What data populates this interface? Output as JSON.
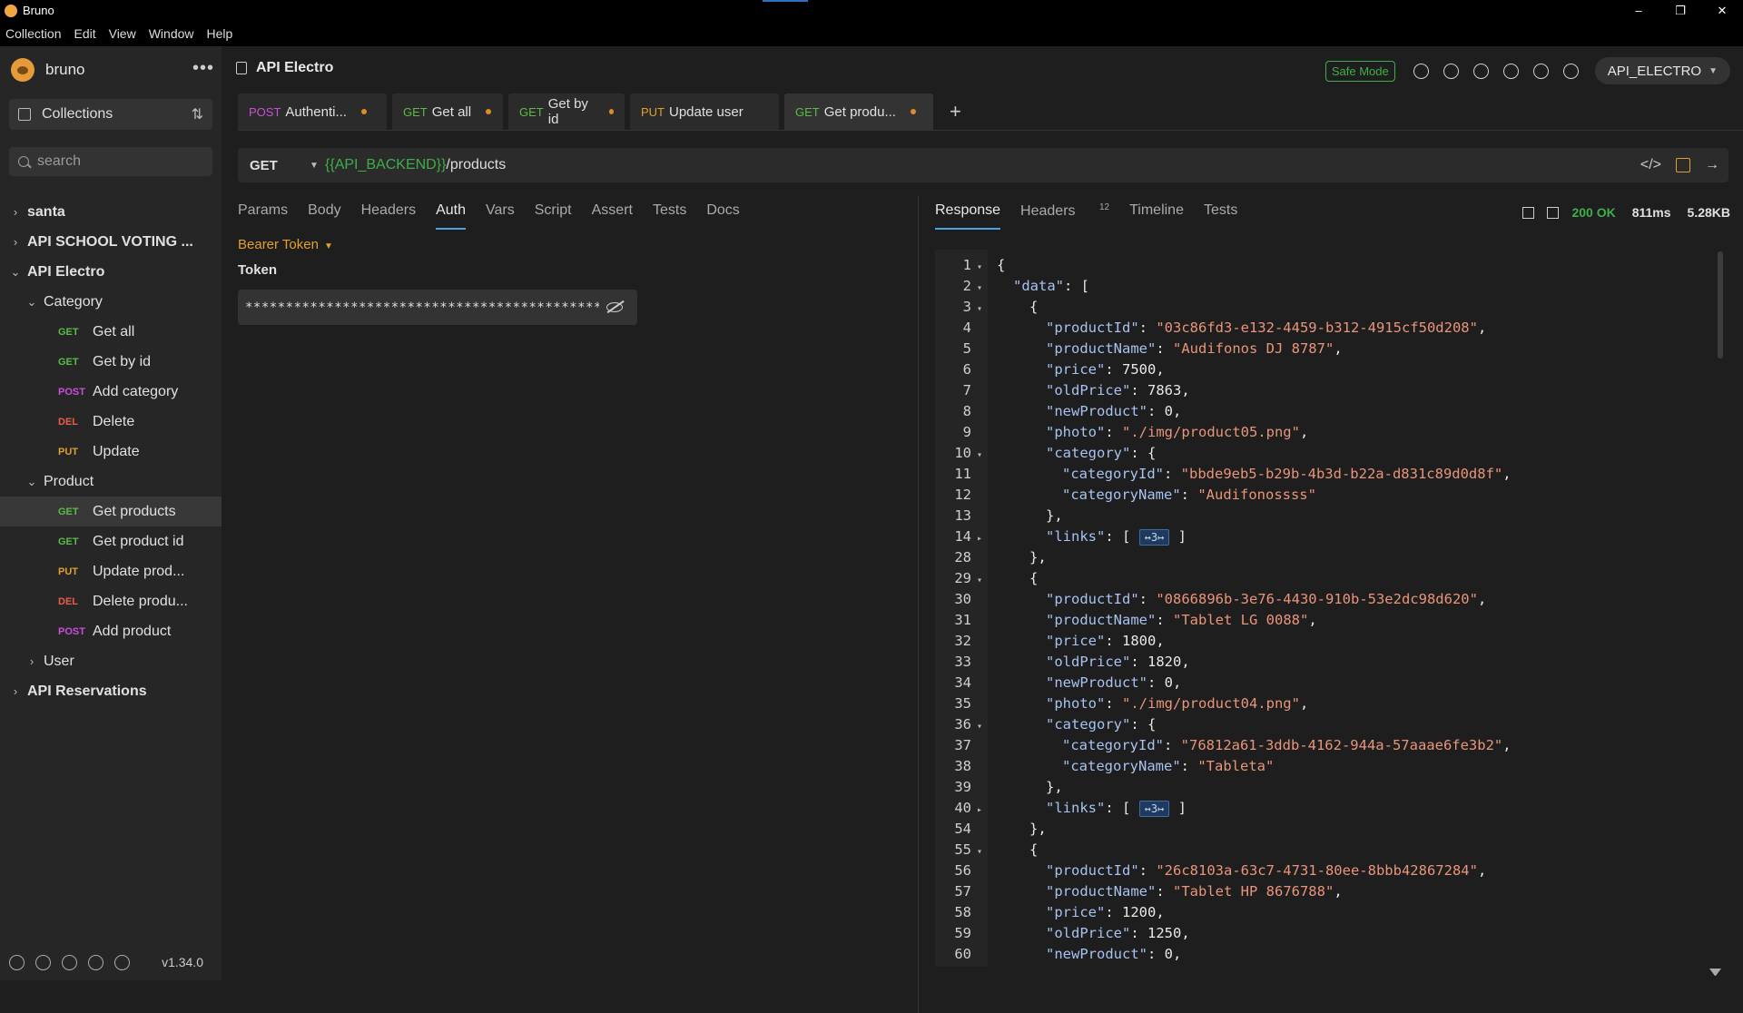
{
  "window": {
    "title": "Bruno",
    "controls": [
      "–",
      "❐",
      "✕"
    ]
  },
  "menu": [
    "Collection",
    "Edit",
    "View",
    "Window",
    "Help"
  ],
  "sidebar": {
    "brand": "bruno",
    "collections_label": "Collections",
    "search_placeholder": "search",
    "tree": [
      {
        "label": "santa",
        "level": 0,
        "chev": "›",
        "bold": true
      },
      {
        "label": "API SCHOOL VOTING ...",
        "level": 0,
        "chev": "›",
        "bold": true
      },
      {
        "label": "API Electro",
        "level": 0,
        "chev": "⌄",
        "bold": true
      },
      {
        "label": "Category",
        "level": 1,
        "chev": "⌄"
      },
      {
        "label": "Get all",
        "level": 2,
        "method": "GET"
      },
      {
        "label": "Get by id",
        "level": 2,
        "method": "GET"
      },
      {
        "label": "Add category",
        "level": 2,
        "method": "POST"
      },
      {
        "label": "Delete",
        "level": 2,
        "method": "DEL"
      },
      {
        "label": "Update",
        "level": 2,
        "method": "PUT"
      },
      {
        "label": "Product",
        "level": 1,
        "chev": "⌄"
      },
      {
        "label": "Get products",
        "level": 2,
        "method": "GET",
        "selected": true
      },
      {
        "label": "Get product id",
        "level": 2,
        "method": "GET"
      },
      {
        "label": "Update prod...",
        "level": 2,
        "method": "PUT"
      },
      {
        "label": "Delete produ...",
        "level": 2,
        "method": "DEL"
      },
      {
        "label": "Add product",
        "level": 2,
        "method": "POST"
      },
      {
        "label": "User",
        "level": 1,
        "chev": "›"
      },
      {
        "label": "API Reservations",
        "level": 0,
        "chev": "›",
        "bold": true
      }
    ],
    "version": "v1.34.0"
  },
  "header": {
    "collection_title": "API Electro",
    "safe_mode": "Safe Mode",
    "environment": "API_ELECTRO"
  },
  "tabs": [
    {
      "method": "POST",
      "label": "Authenti...",
      "unsaved": true
    },
    {
      "method": "GET",
      "label": "Get all",
      "unsaved": true
    },
    {
      "method": "GET",
      "label": "Get by id",
      "unsaved": true
    },
    {
      "method": "PUT",
      "label": "Update user",
      "unsaved": false
    },
    {
      "method": "GET",
      "label": "Get produ...",
      "unsaved": true,
      "active": true
    }
  ],
  "request": {
    "method": "GET",
    "url_variable": "{{API_BACKEND}}",
    "url_path": "/products",
    "tabs": [
      "Params",
      "Body",
      "Headers",
      "Auth",
      "Vars",
      "Script",
      "Assert",
      "Tests",
      "Docs"
    ],
    "active_tab": "Auth",
    "auth_mode": "Bearer Token",
    "token_label": "Token",
    "token_masked": "**************************************************"
  },
  "response": {
    "tabs": [
      "Response",
      "Headers",
      "Timeline",
      "Tests"
    ],
    "headers_count": "12",
    "status": "200 OK",
    "time": "811ms",
    "size": "5.28KB",
    "lines": [
      {
        "n": "1",
        "fold": "▾",
        "indent": 0,
        "text": "{"
      },
      {
        "n": "2",
        "fold": "▾",
        "indent": 1,
        "key": "\"data\"",
        "rest": ": ["
      },
      {
        "n": "3",
        "fold": "▾",
        "indent": 2,
        "text": "{"
      },
      {
        "n": "4",
        "fold": "",
        "indent": 3,
        "key": "\"productId\"",
        "str": "\"03c86fd3-e132-4459-b312-4915cf50d208\"",
        "tail": ","
      },
      {
        "n": "5",
        "fold": "",
        "indent": 3,
        "key": "\"productName\"",
        "str": "\"Audifonos DJ 8787\"",
        "tail": ","
      },
      {
        "n": "6",
        "fold": "",
        "indent": 3,
        "key": "\"price\"",
        "num": "7500",
        "tail": ","
      },
      {
        "n": "7",
        "fold": "",
        "indent": 3,
        "key": "\"oldPrice\"",
        "num": "7863",
        "tail": ","
      },
      {
        "n": "8",
        "fold": "",
        "indent": 3,
        "key": "\"newProduct\"",
        "num": "0",
        "tail": ","
      },
      {
        "n": "9",
        "fold": "",
        "indent": 3,
        "key": "\"photo\"",
        "str": "\"./img/product05.png\"",
        "tail": ","
      },
      {
        "n": "10",
        "fold": "▾",
        "indent": 3,
        "key": "\"category\"",
        "rest": ": {"
      },
      {
        "n": "11",
        "fold": "",
        "indent": 4,
        "key": "\"categoryId\"",
        "str": "\"bbde9eb5-b29b-4b3d-b22a-d831c89d0d8f\"",
        "tail": ","
      },
      {
        "n": "12",
        "fold": "",
        "indent": 4,
        "key": "\"categoryName\"",
        "str": "\"Audifonossss\"",
        "tail": ""
      },
      {
        "n": "13",
        "fold": "",
        "indent": 3,
        "text": "},"
      },
      {
        "n": "14",
        "fold": "▸",
        "indent": 3,
        "key": "\"links\"",
        "rest": ": [ ",
        "chip": "↔3↦",
        "after": " ]"
      },
      {
        "n": "28",
        "fold": "",
        "indent": 2,
        "text": "},"
      },
      {
        "n": "29",
        "fold": "▾",
        "indent": 2,
        "text": "{"
      },
      {
        "n": "30",
        "fold": "",
        "indent": 3,
        "key": "\"productId\"",
        "str": "\"0866896b-3e76-4430-910b-53e2dc98d620\"",
        "tail": ","
      },
      {
        "n": "31",
        "fold": "",
        "indent": 3,
        "key": "\"productName\"",
        "str": "\"Tablet LG 0088\"",
        "tail": ","
      },
      {
        "n": "32",
        "fold": "",
        "indent": 3,
        "key": "\"price\"",
        "num": "1800",
        "tail": ","
      },
      {
        "n": "33",
        "fold": "",
        "indent": 3,
        "key": "\"oldPrice\"",
        "num": "1820",
        "tail": ","
      },
      {
        "n": "34",
        "fold": "",
        "indent": 3,
        "key": "\"newProduct\"",
        "num": "0",
        "tail": ","
      },
      {
        "n": "35",
        "fold": "",
        "indent": 3,
        "key": "\"photo\"",
        "str": "\"./img/product04.png\"",
        "tail": ","
      },
      {
        "n": "36",
        "fold": "▾",
        "indent": 3,
        "key": "\"category\"",
        "rest": ": {"
      },
      {
        "n": "37",
        "fold": "",
        "indent": 4,
        "key": "\"categoryId\"",
        "str": "\"76812a61-3ddb-4162-944a-57aaae6fe3b2\"",
        "tail": ","
      },
      {
        "n": "38",
        "fold": "",
        "indent": 4,
        "key": "\"categoryName\"",
        "str": "\"Tableta\"",
        "tail": ""
      },
      {
        "n": "39",
        "fold": "",
        "indent": 3,
        "text": "},"
      },
      {
        "n": "40",
        "fold": "▸",
        "indent": 3,
        "key": "\"links\"",
        "rest": ": [ ",
        "chip": "↔3↦",
        "after": " ]"
      },
      {
        "n": "54",
        "fold": "",
        "indent": 2,
        "text": "},"
      },
      {
        "n": "55",
        "fold": "▾",
        "indent": 2,
        "text": "{"
      },
      {
        "n": "56",
        "fold": "",
        "indent": 3,
        "key": "\"productId\"",
        "str": "\"26c8103a-63c7-4731-80ee-8bbb42867284\"",
        "tail": ","
      },
      {
        "n": "57",
        "fold": "",
        "indent": 3,
        "key": "\"productName\"",
        "str": "\"Tablet HP 8676788\"",
        "tail": ","
      },
      {
        "n": "58",
        "fold": "",
        "indent": 3,
        "key": "\"price\"",
        "num": "1200",
        "tail": ","
      },
      {
        "n": "59",
        "fold": "",
        "indent": 3,
        "key": "\"oldPrice\"",
        "num": "1250",
        "tail": ","
      },
      {
        "n": "60",
        "fold": "",
        "indent": 3,
        "key": "\"newProduct\"",
        "num": "0",
        "tail": ","
      }
    ]
  }
}
